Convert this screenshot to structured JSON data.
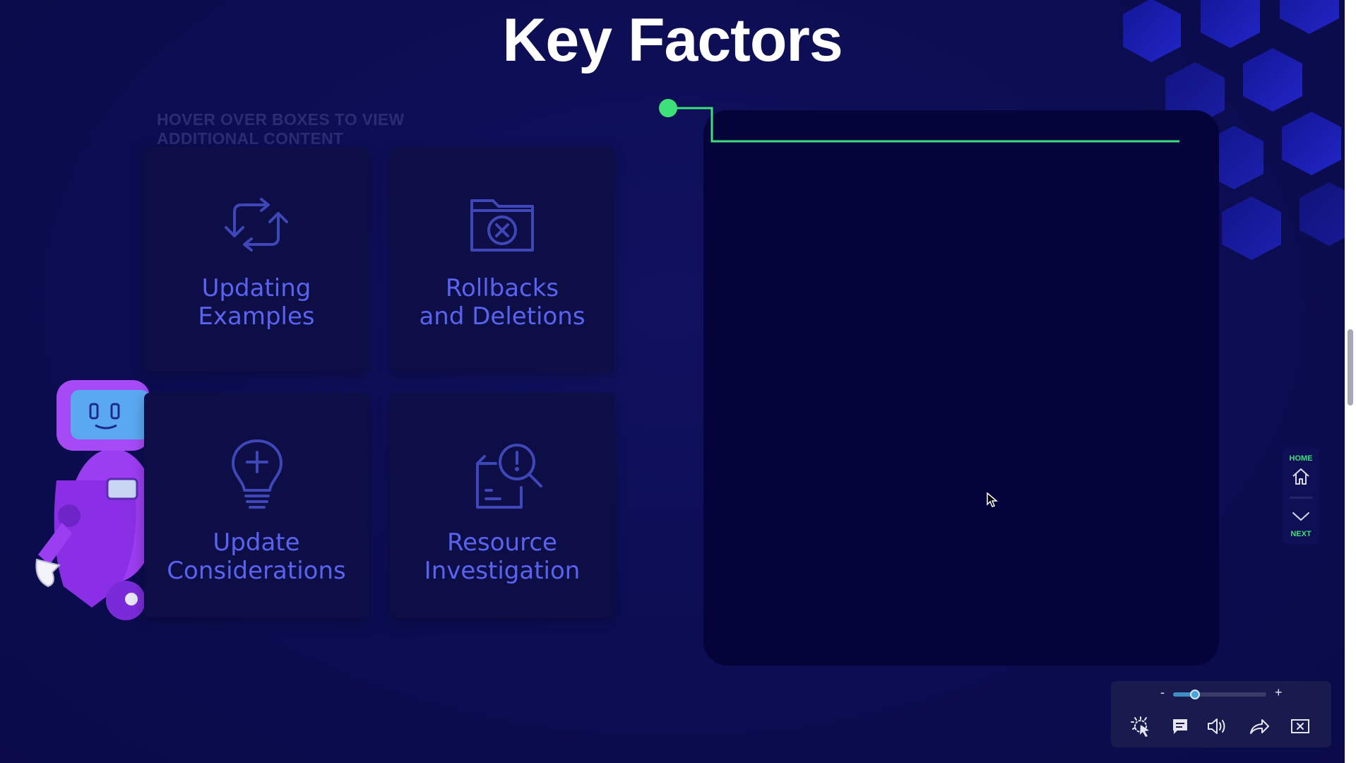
{
  "page": {
    "title": "Key Factors",
    "hint": "HOVER OVER BOXES TO VIEW ADDITIONAL CONTENT"
  },
  "cards": [
    {
      "line1": "Updating",
      "line2": "Examples",
      "icon": "refresh-cycle-icon"
    },
    {
      "line1": "Rollbacks",
      "line2": "and Deletions",
      "icon": "folder-delete-icon"
    },
    {
      "line1": "Update",
      "line2": "Considerations",
      "icon": "lightbulb-plus-icon"
    },
    {
      "line1": "Resource",
      "line2": "Investigation",
      "icon": "document-search-alert-icon"
    }
  ],
  "nav": {
    "home_label": "HOME",
    "next_label": "NEXT"
  },
  "player": {
    "zoom_minus": "-",
    "zoom_plus": "+",
    "zoom_level": 0.2
  },
  "colors": {
    "background": "#0c0d52",
    "card_bg": "#0e0e46",
    "card_text": "#5a63f0",
    "panel_bg": "#04033a",
    "accent_green": "#3ee07a",
    "robot_purple": "#9b3df0"
  }
}
